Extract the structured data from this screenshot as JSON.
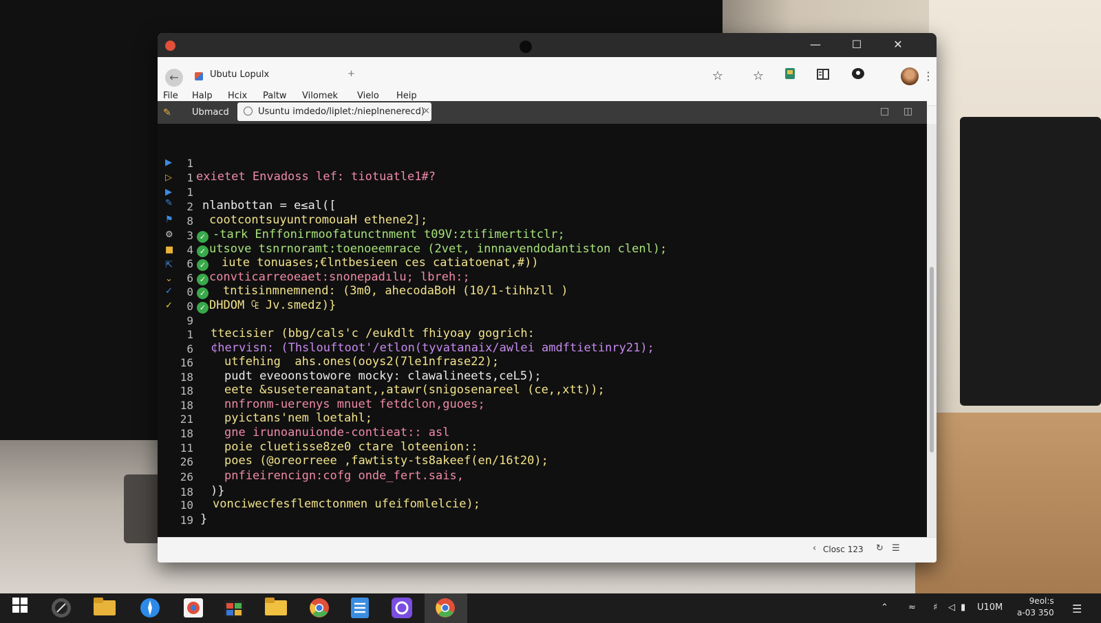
{
  "window": {
    "tab_title": "Ubutu Lopulx",
    "tab_plus": "+",
    "controls": {
      "minimize": "—",
      "maximize": "☐",
      "close": "✕"
    }
  },
  "menu": [
    "File",
    "Halp",
    "Hcix",
    "Paltw",
    "Vilomek",
    "Vielo",
    "Heip"
  ],
  "tabstrip": {
    "label": "Ubmacd",
    "tab_label": "Usuntu imdedo/liplet:/nieplnenerecd)",
    "tab_close": "×"
  },
  "editor": {
    "lines": [
      {
        "num": "1",
        "check": false,
        "text": ""
      },
      {
        "num": "1",
        "check": false,
        "text": "exietet Envadoss lef: tiotuatle1#?"
      },
      {
        "num": "1",
        "check": false,
        "text": ""
      },
      {
        "num": "2",
        "check": false,
        "text": "nlanbottan = e≤al(["
      },
      {
        "num": "8",
        "check": false,
        "text": "cootcontsuyuntromouaH ethene2];"
      },
      {
        "num": "3",
        "check": true,
        "text": "-tark Enffonirmoofatunctnment t09V:ztifimertitclr;"
      },
      {
        "num": "4",
        "check": true,
        "text": "utsove tsnrnoramt:toenoeemrace (2vet, innnavendodantiston clenl);"
      },
      {
        "num": "6",
        "check": true,
        "text": "iute tonuases;€lntbesieen ces catiatoenat,#))"
      },
      {
        "num": "6",
        "check": true,
        "text": "convticarreoeaet:snonepadılu; lbreh:;"
      },
      {
        "num": "0",
        "check": true,
        "text": "tntisinmnemnend: (3m0, ahecodaBoH (10/1-tihhzll )"
      },
      {
        "num": "0",
        "check": true,
        "text": "DHDOM ₠ Jv.smedz)}"
      },
      {
        "num": "9",
        "check": false,
        "text": ""
      },
      {
        "num": "1",
        "check": false,
        "text": "ttecisier (bbg/cals'c /eukdlt fhiyoay gogrich:"
      },
      {
        "num": "6",
        "check": false,
        "text": "¢hervisn: (Thslouftoot'/etlon(tyvatanaix/awlei amdftietinry21);"
      },
      {
        "num": "16",
        "check": false,
        "text": "utfehing  ahs.ones(ooys2(7le1nfrase22);"
      },
      {
        "num": "18",
        "check": false,
        "text": "pudt eveoonstowore mocky: clawalineets,ceL5);"
      },
      {
        "num": "18",
        "check": false,
        "text": "eete &susetereanatant,,atawr(snigosenareel (ce,,xtt));"
      },
      {
        "num": "18",
        "check": false,
        "text": "nnfronm-uerenys mnuet fetdclon,guoes;"
      },
      {
        "num": "21",
        "check": false,
        "text": "pyictans'nem loetahl;"
      },
      {
        "num": "18",
        "check": false,
        "text": "gne irunoanuionde-contieat:: asl"
      },
      {
        "num": "11",
        "check": false,
        "text": "poie cluetisse8ze0 ctare loteenion::"
      },
      {
        "num": "26",
        "check": false,
        "text": "poes (@oreorreee ,fawtisty-ts8akeef(en/16t20);"
      },
      {
        "num": "26",
        "check": false,
        "text": "pnfieirencign:cofg onde_fert.sais,"
      },
      {
        "num": "18",
        "check": false,
        "text": ")}"
      },
      {
        "num": "10",
        "check": false,
        "text": "vonciwecfesflemctonmen ufeifomlelcie);"
      },
      {
        "num": "19",
        "check": false,
        "text": "}"
      }
    ]
  },
  "status": {
    "text": "Closc 123"
  },
  "clock": {
    "time": "9eol:s",
    "date": "a-03 350"
  },
  "tray": {
    "lang": "U10M"
  }
}
